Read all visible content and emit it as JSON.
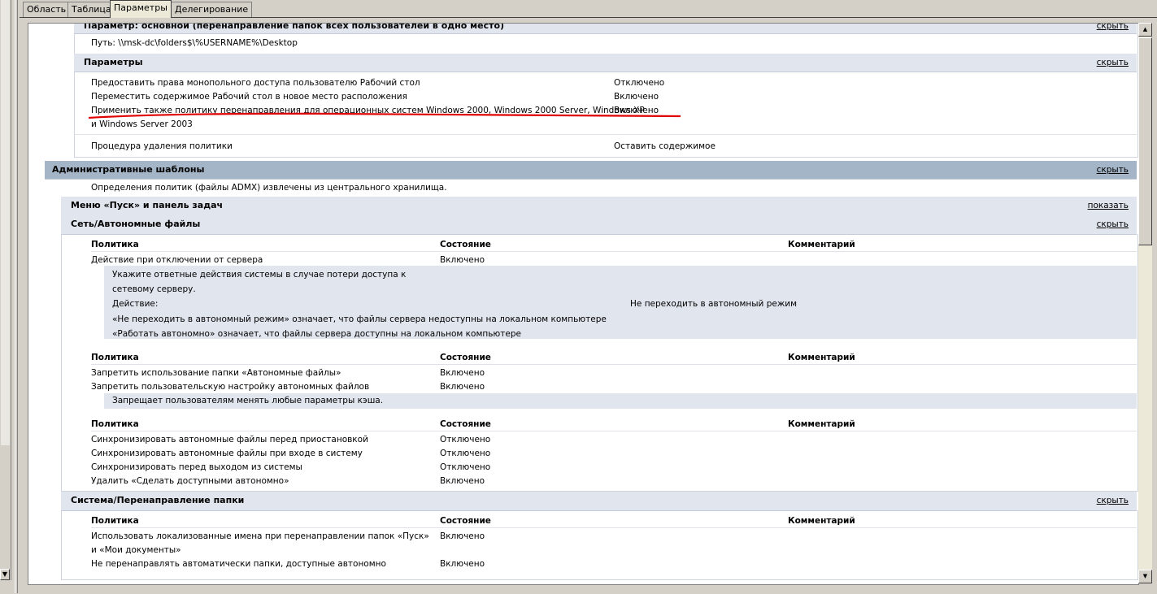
{
  "tabs": [
    "Область",
    "Таблица",
    "Параметры",
    "Делегирование"
  ],
  "links": {
    "hide": "скрыть",
    "show": "показать"
  },
  "top_section": {
    "title": "Параметр: основной (перенаправление папок всех пользователей в одно место)",
    "path": "Путь: \\\\msk-dc\\folders$\\%USERNAME%\\Desktop"
  },
  "params": {
    "title": "Параметры",
    "rows": [
      {
        "name": "Предоставить права монопольного доступа пользователю Рабочий стол",
        "value": "Отключено"
      },
      {
        "name": "Переместить содержимое Рабочий стол в новое место расположения",
        "value": "Включено"
      },
      {
        "name": "Применить также политику перенаправления для операционных систем Windows 2000, Windows 2000 Server, Windows XP",
        "name2": "и Windows Server 2003",
        "value": "Включено"
      },
      {
        "name": "Процедура удаления политики",
        "value": "Оставить содержимое"
      }
    ]
  },
  "admin": {
    "title": "Административные шаблоны",
    "note": "Определения политик (файлы ADMX) извлечены из центрального хранилища."
  },
  "start_menu": {
    "title": "Меню «Пуск» и панель задач"
  },
  "offline": {
    "title": "Сеть/Автономные файлы",
    "headers": {
      "policy": "Политика",
      "state": "Состояние",
      "comment": "Комментарий"
    },
    "g1": {
      "rows": [
        {
          "name": "Действие при отключении от сервера",
          "state": "Включено"
        }
      ],
      "expl": {
        "l1": "Укажите ответные действия системы в случае потери доступа к",
        "l2": "сетевому серверу.",
        "action_label": "Действие:",
        "action_value": "Не переходить в автономный режим",
        "l4": "«Не переходить в автономный режим» означает, что файлы сервера недоступны на локальном компьютере",
        "l5": "«Работать автономно» означает, что файлы сервера доступны на локальном компьютере"
      }
    },
    "g2": {
      "rows": [
        {
          "name": "Запретить использование папки «Автономные файлы»",
          "state": "Включено"
        },
        {
          "name": "Запретить пользовательскую настройку автономных файлов",
          "state": "Включено"
        }
      ],
      "expl": "Запрещает пользователям менять любые параметры кэша."
    },
    "g3": {
      "rows": [
        {
          "name": "Синхронизировать автономные файлы перед приостановкой",
          "state": "Отключено"
        },
        {
          "name": "Синхронизировать автономные файлы при входе в систему",
          "state": "Отключено"
        },
        {
          "name": "Синхронизировать перед выходом из системы",
          "state": "Отключено"
        },
        {
          "name": "Удалить «Сделать доступными автономно»",
          "state": "Включено"
        }
      ]
    }
  },
  "redirect": {
    "title": "Система/Перенаправление папки",
    "rows": [
      {
        "name": "Использовать локализованные имена при перенаправлении папок «Пуск»",
        "name2": "и «Мои документы»",
        "state": "Включено"
      },
      {
        "name": "Не перенаправлять автоматически папки, доступные автономно",
        "state": "Включено"
      }
    ]
  },
  "colors": {
    "highlight": "#e00000",
    "header_dark": "#a4b5c8",
    "header_light": "#e1e5ee"
  }
}
